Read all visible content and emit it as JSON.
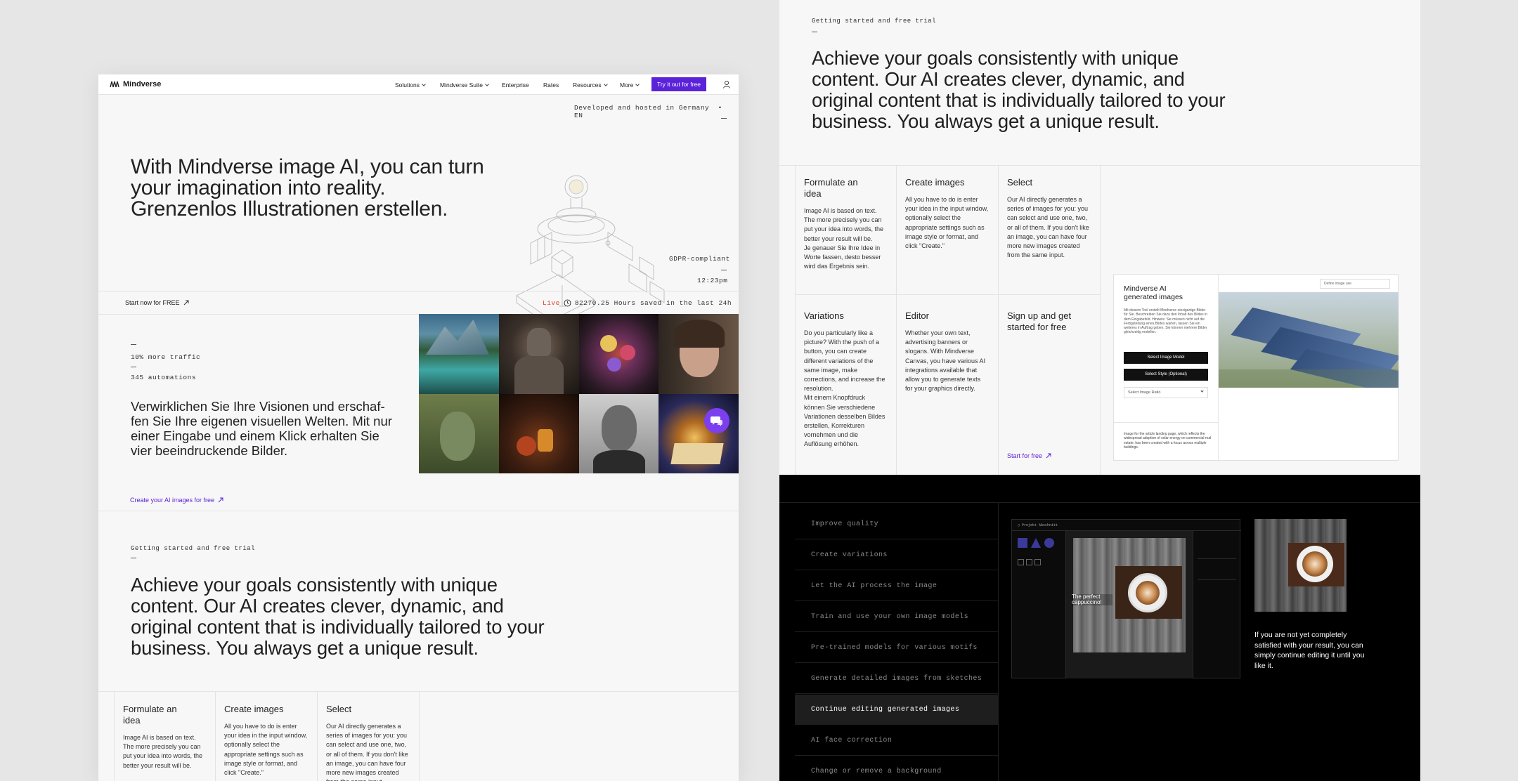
{
  "nav": {
    "brand": "Mindverse",
    "items": [
      {
        "label": "Solutions",
        "dropdown": true
      },
      {
        "label": "Mindverse Suite",
        "dropdown": true
      },
      {
        "label": "Enterprise",
        "dropdown": false
      },
      {
        "label": "Rates",
        "dropdown": false
      },
      {
        "label": "Resources",
        "dropdown": true
      },
      {
        "label": "More",
        "dropdown": true
      }
    ],
    "cta": "Try it out for free",
    "user_icon": "user-icon",
    "accent": "#5b22d9"
  },
  "hero": {
    "hosted": "Developed and hosted in Germany",
    "lang": "EN",
    "headline": "With Mindverse image AI, you can turn your imagination into reality. Grenzenlos Illustrationen erstellen.",
    "gdpr": "GDPR-compliant",
    "time": "12:23pm"
  },
  "strip": {
    "start": "Start now for FREE",
    "live": "Live",
    "hours": "82270.25 Hours saved in the last 24h"
  },
  "stats": {
    "traffic": "10% more traffic",
    "automations": "345 automations",
    "body": "Verwirklichen Sie Ihre Visionen und erschaf-fen Sie Ihre eigenen visuellen Welten. Mit nur einer Eingabe und einem Klick erhalten Sie vier beeindruckende Bilder.",
    "create_link": "Create your AI images for free"
  },
  "gallery": {
    "tiles": [
      "mountain-lake-image",
      "knight-image",
      "flowers-image",
      "woman-portrait-image",
      "tree-woman-image",
      "still-life-image",
      "man-portrait-image",
      "magic-book-image"
    ],
    "chat_icon": "chat-icon"
  },
  "getting_started": {
    "eyebrow": "Getting started and free trial",
    "headline": "Achieve your goals consistently with unique content. Our AI creates clever, dynamic, and original content that is individually tailored to your business. You always get a unique result."
  },
  "steps": [
    {
      "title": "Formulate an idea",
      "text": "Image AI is based on text. The more precisely you can put your idea into words, the better your result will be.",
      "text_de": "Je genauer Sie Ihre Idee in Worte fassen, desto besser wird das Ergebnis sein."
    },
    {
      "title": "Create images",
      "text": "All you have to do is enter your idea in the input window, optionally select the appropriate settings such as image style or format, and click \"Create.\""
    },
    {
      "title": "Select",
      "text": "Our AI directly generates a series of images for you: you can select and use one, two, or all of them. If you don't like an image, you can have four more new images created from the same input."
    },
    {
      "title": "Variations",
      "text": "Do you particularly like a picture? With the push of a button, you can create different variations of the same image, make corrections, and increase the resolution.",
      "text_de": "Mit einem Knopfdruck können Sie verschiedene Variationen desselben Bildes erstellen, Korrekturen vornehmen und die Auflösung erhöhen."
    },
    {
      "title": "Editor",
      "text": "Whether your own text, advertising banners or slogans. With Mindverse Canvas, you have various AI integrations available that allow you to generate texts for your graphics directly."
    },
    {
      "title": "Sign up and get started for free",
      "link": "Start for free"
    }
  ],
  "preview": {
    "title": "Mindverse AI generated images",
    "desc": "Mit diesem Tool erstellt Mindverse einzigartige Bilder für Sie. Beschreiben Sie dazu den Inhalt des Bildes in dem Eingabefeld. Hinweis: Sie müssen nicht auf die Fertigstellung eines Bildes warten, lassen Sie ein weiteres in Auftrag geben. Sie können mehrere Bilder gleichzeitig erstellen.",
    "btn_model": "Select Image Model",
    "btn_style": "Select Style (Optional)",
    "ratio": "Select Image Ratio",
    "define": "Define image use",
    "prompt": "Image for the article landing page, which reflects the widespread adoption of solar energy on commercial real estate, has been created with a focus across multiple buildings."
  },
  "features": {
    "items": [
      "Improve quality",
      "Create variations",
      "Let the AI process the image",
      "Train and use your own image models",
      "Pre-trained models for various motifs",
      "Generate detailed images from sketches",
      "Continue editing generated images",
      "AI face correction",
      "Change or remove a background"
    ],
    "active_index": 6,
    "editor_title": "Projekt Abschnitt",
    "editor_caption": "The perfect cappuccino!",
    "side_text": "If you are not yet completely satisfied with your result, you can simply continue editing it until you like it."
  }
}
